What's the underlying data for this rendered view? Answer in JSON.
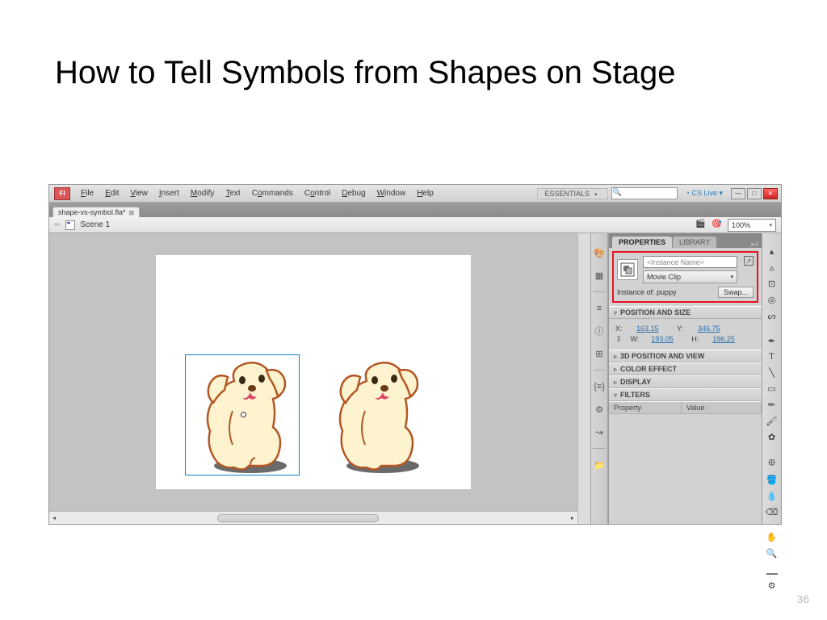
{
  "slide": {
    "title": "How to Tell Symbols from Shapes on Stage",
    "page_number": "36"
  },
  "menubar": {
    "app_icon": "Fl",
    "items": [
      "File",
      "Edit",
      "View",
      "Insert",
      "Modify",
      "Text",
      "Commands",
      "Control",
      "Debug",
      "Window",
      "Help"
    ],
    "workspace": "ESSENTIALS",
    "cs_live": "CS Live"
  },
  "file_tab": {
    "name": "shape-vs-symbol.fla*"
  },
  "scenebar": {
    "scene_label": "Scene 1",
    "zoom": "100%"
  },
  "properties": {
    "tabs": {
      "properties": "PROPERTIES",
      "library": "LIBRARY"
    },
    "instance_name_placeholder": "<Instance Name>",
    "type": "Movie Clip",
    "instance_of_label": "Instance of:",
    "instance_of_value": "puppy",
    "swap_label": "Swap...",
    "sections": {
      "position_size": "POSITION AND SIZE",
      "position_3d": "3D POSITION AND VIEW",
      "color_effect": "COLOR EFFECT",
      "display": "DISPLAY",
      "filters": "FILTERS"
    },
    "pos": {
      "x_label": "X:",
      "x": "163.15",
      "y_label": "Y:",
      "y": "346.75",
      "w_label": "W:",
      "w": "193.05",
      "h_label": "H:",
      "h": "196.25"
    },
    "filter_columns": {
      "property": "Property",
      "value": "Value"
    }
  }
}
